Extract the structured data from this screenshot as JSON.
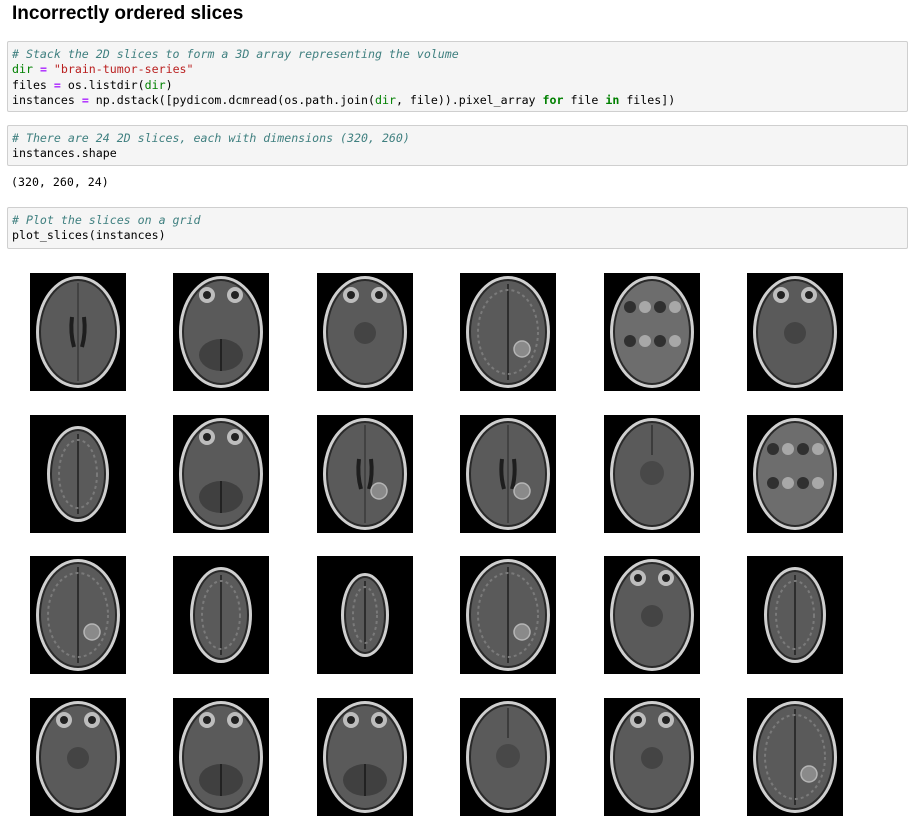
{
  "heading": "Incorrectly ordered slices",
  "cells": [
    {
      "lines": [
        [
          {
            "t": "# Stack the 2D slices to form a 3D array representing the volume",
            "c": "cm"
          }
        ],
        [
          {
            "t": "dir",
            "c": "vr"
          },
          {
            "t": " "
          },
          {
            "t": "=",
            "c": "op"
          },
          {
            "t": " "
          },
          {
            "t": "\"brain-tumor-series\"",
            "c": "st"
          }
        ],
        [
          {
            "t": "files "
          },
          {
            "t": "=",
            "c": "op"
          },
          {
            "t": " os.listdir("
          },
          {
            "t": "dir",
            "c": "vr"
          },
          {
            "t": ")"
          }
        ],
        [
          {
            "t": "instances "
          },
          {
            "t": "=",
            "c": "op"
          },
          {
            "t": " np.dstack([pydicom.dcmread(os.path.join("
          },
          {
            "t": "dir",
            "c": "vr"
          },
          {
            "t": ", file)).pixel_array "
          },
          {
            "t": "for",
            "c": "kw"
          },
          {
            "t": " file "
          },
          {
            "t": "in",
            "c": "kw"
          },
          {
            "t": " files])"
          }
        ]
      ]
    },
    {
      "lines": [
        [
          {
            "t": "# There are 24 2D slices, each with dimensions (320, 260)",
            "c": "cm"
          }
        ],
        [
          {
            "t": "instances.shape"
          }
        ]
      ]
    },
    {
      "lines": [
        [
          {
            "t": "# Plot the slices on a grid",
            "c": "cm"
          }
        ],
        [
          {
            "t": "plot_slices(instances)"
          }
        ]
      ]
    }
  ],
  "shape_output": "(320, 260, 24)",
  "slices": [
    {
      "kind": "ventricles"
    },
    {
      "kind": "orbits-cerebellum"
    },
    {
      "kind": "orbits-midbrain"
    },
    {
      "kind": "vertex-tumor"
    },
    {
      "kind": "skull-base"
    },
    {
      "kind": "orbits-high"
    },
    {
      "kind": "vertex"
    },
    {
      "kind": "orbits-cerebellum"
    },
    {
      "kind": "ventricles-tumor"
    },
    {
      "kind": "ventricles-tumor"
    },
    {
      "kind": "midbrain"
    },
    {
      "kind": "skull-base"
    },
    {
      "kind": "vertex-tumor"
    },
    {
      "kind": "vertex"
    },
    {
      "kind": "vertex-top"
    },
    {
      "kind": "vertex-tumor"
    },
    {
      "kind": "orbits-midbrain"
    },
    {
      "kind": "vertex"
    },
    {
      "kind": "orbits-midbrain"
    },
    {
      "kind": "orbits-cerebellum"
    },
    {
      "kind": "orbits-cerebellum"
    },
    {
      "kind": "midbrain"
    },
    {
      "kind": "orbits-midbrain"
    },
    {
      "kind": "vertex-tumor"
    }
  ]
}
